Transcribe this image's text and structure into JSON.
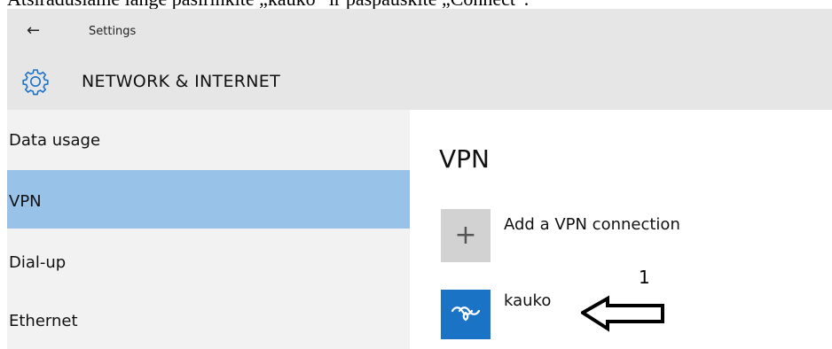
{
  "document": {
    "caption": "Atsiradusiame lange pasirinkite „kauko“ ir paspauskite „Connect“."
  },
  "window": {
    "title": "Settings"
  },
  "header": {
    "section_title": "NETWORK & INTERNET",
    "icon": "gear-icon"
  },
  "sidebar": {
    "items": [
      {
        "label": "Data usage",
        "selected": false
      },
      {
        "label": "VPN",
        "selected": true
      },
      {
        "label": "Dial-up",
        "selected": false
      },
      {
        "label": "Ethernet",
        "selected": false
      }
    ]
  },
  "main": {
    "title": "VPN",
    "add_connection": {
      "label": "Add a VPN connection",
      "icon": "plus-icon"
    },
    "connections": [
      {
        "name": "kauko",
        "icon": "vpn-connection-icon"
      }
    ]
  },
  "annotation": {
    "number": "1"
  },
  "colors": {
    "header_bg": "#e6e6e6",
    "sidebar_bg": "#f2f2f2",
    "selected_bg": "#99c2e8",
    "vpn_tile": "#1a73c4",
    "add_tile": "#d2d2d2"
  }
}
